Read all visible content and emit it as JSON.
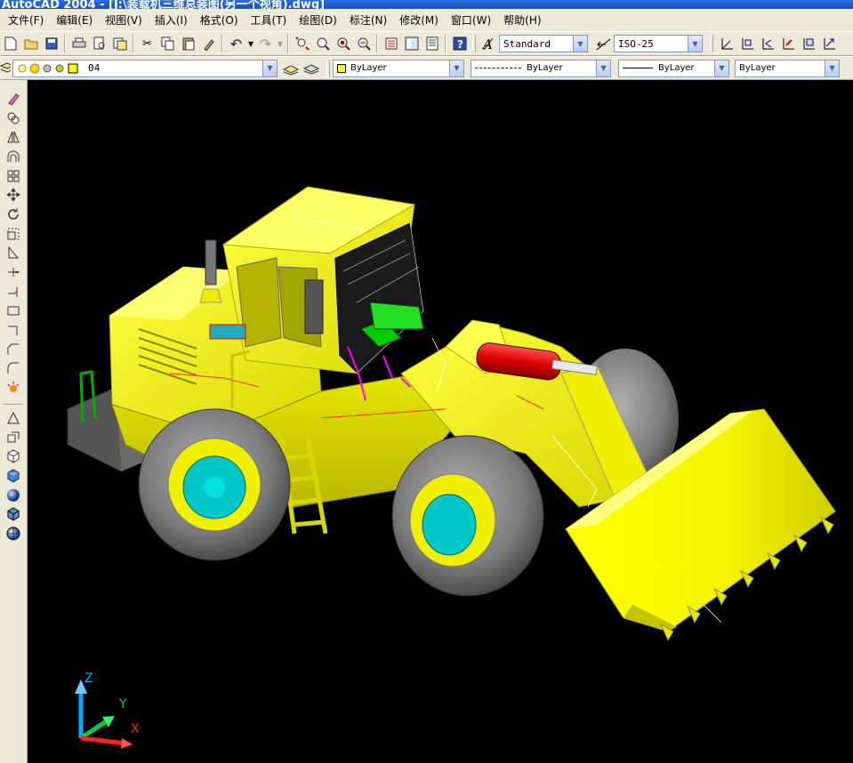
{
  "window": {
    "title": "AutoCAD 2004 - [J:\\装载机三维总装图(另一个视角).dwg]"
  },
  "menu": [
    "文件(F)",
    "编辑(E)",
    "视图(V)",
    "插入(I)",
    "格式(O)",
    "工具(T)",
    "绘图(D)",
    "标注(N)",
    "修改(M)",
    "窗口(W)",
    "帮助(H)"
  ],
  "toolbar": {
    "text_style": "Standard",
    "dim_style": "ISO-25"
  },
  "properties": {
    "layer": "04",
    "color": "ByLayer",
    "linetype": "ByLayer",
    "lineweight": "ByLayer",
    "plotstyle": "ByLayer"
  },
  "ucs": {
    "z": "Z",
    "y": "Y",
    "x": "X"
  },
  "colors": {
    "model_body": "#f0f000",
    "tire": "#7a7a7a",
    "hub": "#00c8c8",
    "cylinder": "#dd0000",
    "background": "#000000"
  }
}
